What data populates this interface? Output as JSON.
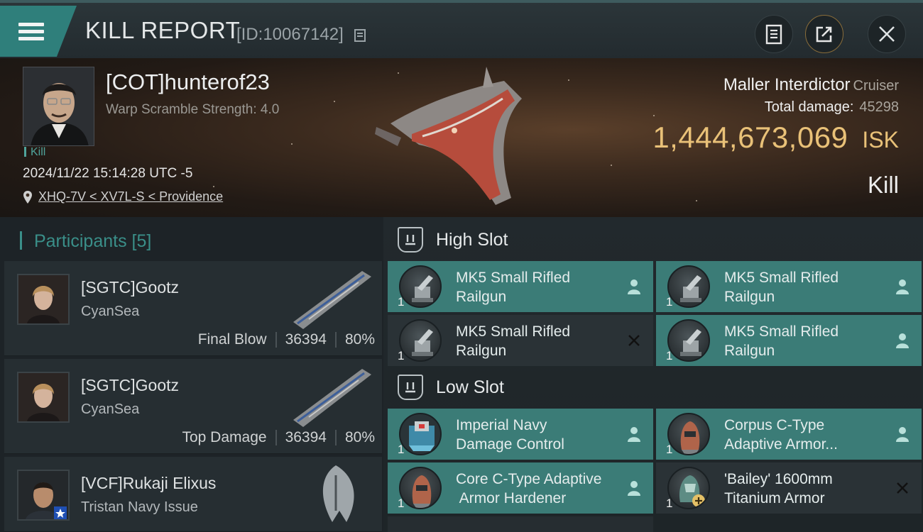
{
  "header": {
    "title": "KILL REPORT",
    "report_id": "[ID:10067142]"
  },
  "victim": {
    "name": "[COT]hunterof23",
    "stat": "Warp Scramble Strength: 4.0",
    "tag": "Kill",
    "datetime": "2024/11/22 15:14:28 UTC -5",
    "location": "XHQ-7V < XV7L-S < Providence"
  },
  "ship": {
    "name": "Maller Interdictor",
    "class": "Cruiser",
    "damage_label": "Total damage:",
    "damage_value": "45298",
    "isk_amount": "1,444,673,069",
    "isk_unit": "ISK",
    "result": "Kill"
  },
  "participants": {
    "label": "Participants",
    "count": "[5]",
    "items": [
      {
        "name": "[SGTC]Gootz",
        "ship": "CyanSea",
        "role": "Final Blow",
        "damage": "36394",
        "percent": "80%"
      },
      {
        "name": "[SGTC]Gootz",
        "ship": "CyanSea",
        "role": "Top Damage",
        "damage": "36394",
        "percent": "80%"
      },
      {
        "name": "[VCF]Rukaji Elixus",
        "ship": "Tristan Navy Issue"
      }
    ]
  },
  "fitting": {
    "high_slot_label": "High Slot",
    "low_slot_label": "Low Slot",
    "high": [
      {
        "line1": "MK5 Small Rifled",
        "line2": "Railgun",
        "qty": "1",
        "state": "person-icon"
      },
      {
        "line1": "MK5 Small Rifled",
        "line2": "Railgun",
        "qty": "1",
        "state": "person-icon"
      },
      {
        "line1": "MK5 Small Rifled",
        "line2": "Railgun",
        "qty": "1",
        "state": "destroyed-x-icon"
      },
      {
        "line1": "MK5 Small Rifled",
        "line2": "Railgun",
        "qty": "1",
        "state": "person-icon"
      }
    ],
    "low": [
      {
        "line1": "Imperial Navy",
        "line2": "Damage Control",
        "qty": "1",
        "state": "person-icon"
      },
      {
        "line1": "Corpus C-Type",
        "line2": "Adaptive Armor...",
        "qty": "1",
        "state": "person-icon"
      },
      {
        "line1": "Core C-Type Adaptive",
        "line2": " Armor Hardener",
        "qty": "1",
        "state": "person-icon"
      },
      {
        "line1": "'Bailey' 1600mm",
        "line2": "Titanium Armor",
        "qty": "1",
        "state": "destroyed-x-icon"
      }
    ]
  },
  "colors": {
    "teal_accent": "#3a8f89",
    "isk_gold": "#e9c178",
    "module_dropped": "#3b7c77",
    "module_destroyed": "#2a3236"
  }
}
